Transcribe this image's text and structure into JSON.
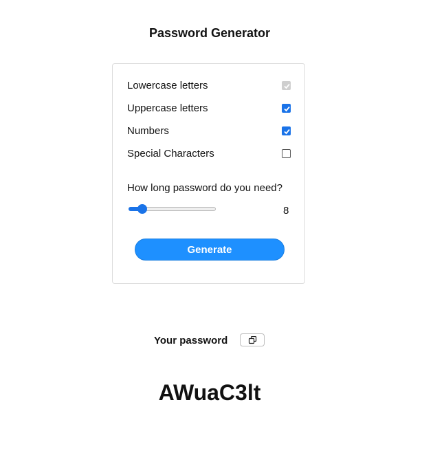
{
  "app": {
    "title": "Password Generator"
  },
  "options": [
    {
      "label": "Lowercase letters",
      "checked": true,
      "disabled": true
    },
    {
      "label": "Uppercase letters",
      "checked": true,
      "disabled": false
    },
    {
      "label": "Numbers",
      "checked": true,
      "disabled": false
    },
    {
      "label": "Special Characters",
      "checked": false,
      "disabled": false
    }
  ],
  "length": {
    "question": "How long password do you need?",
    "value": "8",
    "slider_fraction": 0.1
  },
  "actions": {
    "generate_label": "Generate"
  },
  "result": {
    "label": "Your password",
    "copy_icon": "copy-icon",
    "password": "AWuaC3lt"
  },
  "colors": {
    "accent": "#1e90ff",
    "checkbox": "#1a73e8",
    "disabled": "#cfcfcf"
  }
}
